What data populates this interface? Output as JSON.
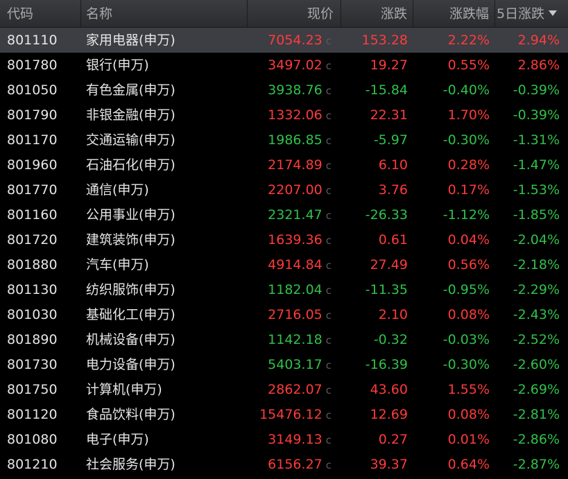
{
  "headers": {
    "code": "代码",
    "name": "名称",
    "price": "现价",
    "change": "涨跌",
    "pct": "涨跌幅",
    "five": "5日涨跌"
  },
  "cmark": "c",
  "colors": {
    "up": "#ff3b3b",
    "down": "#2fc24b",
    "selected_row": "#3c3e44"
  },
  "rows": [
    {
      "code": "801110",
      "name": "家用电器(申万)",
      "price": "7054.23",
      "change": "153.28",
      "pct": "2.22%",
      "five": "2.94%",
      "price_dir": "up",
      "change_dir": "up",
      "pct_dir": "up",
      "five_dir": "up"
    },
    {
      "code": "801780",
      "name": "银行(申万)",
      "price": "3497.02",
      "change": "19.27",
      "pct": "0.55%",
      "five": "2.86%",
      "price_dir": "up",
      "change_dir": "up",
      "pct_dir": "up",
      "five_dir": "up"
    },
    {
      "code": "801050",
      "name": "有色金属(申万)",
      "price": "3938.76",
      "change": "-15.84",
      "pct": "-0.40%",
      "five": "-0.39%",
      "price_dir": "down",
      "change_dir": "down",
      "pct_dir": "down",
      "five_dir": "down"
    },
    {
      "code": "801790",
      "name": "非银金融(申万)",
      "price": "1332.06",
      "change": "22.31",
      "pct": "1.70%",
      "five": "-0.39%",
      "price_dir": "up",
      "change_dir": "up",
      "pct_dir": "up",
      "five_dir": "down"
    },
    {
      "code": "801170",
      "name": "交通运输(申万)",
      "price": "1986.85",
      "change": "-5.97",
      "pct": "-0.30%",
      "five": "-1.31%",
      "price_dir": "down",
      "change_dir": "down",
      "pct_dir": "down",
      "five_dir": "down"
    },
    {
      "code": "801960",
      "name": "石油石化(申万)",
      "price": "2174.89",
      "change": "6.10",
      "pct": "0.28%",
      "five": "-1.47%",
      "price_dir": "up",
      "change_dir": "up",
      "pct_dir": "up",
      "five_dir": "down"
    },
    {
      "code": "801770",
      "name": "通信(申万)",
      "price": "2207.00",
      "change": "3.76",
      "pct": "0.17%",
      "five": "-1.53%",
      "price_dir": "up",
      "change_dir": "up",
      "pct_dir": "up",
      "five_dir": "down"
    },
    {
      "code": "801160",
      "name": "公用事业(申万)",
      "price": "2321.47",
      "change": "-26.33",
      "pct": "-1.12%",
      "five": "-1.85%",
      "price_dir": "down",
      "change_dir": "down",
      "pct_dir": "down",
      "five_dir": "down"
    },
    {
      "code": "801720",
      "name": "建筑装饰(申万)",
      "price": "1639.36",
      "change": "0.61",
      "pct": "0.04%",
      "five": "-2.04%",
      "price_dir": "up",
      "change_dir": "up",
      "pct_dir": "up",
      "five_dir": "down"
    },
    {
      "code": "801880",
      "name": "汽车(申万)",
      "price": "4914.84",
      "change": "27.49",
      "pct": "0.56%",
      "five": "-2.18%",
      "price_dir": "up",
      "change_dir": "up",
      "pct_dir": "up",
      "five_dir": "down"
    },
    {
      "code": "801130",
      "name": "纺织服饰(申万)",
      "price": "1182.04",
      "change": "-11.35",
      "pct": "-0.95%",
      "five": "-2.29%",
      "price_dir": "down",
      "change_dir": "down",
      "pct_dir": "down",
      "five_dir": "down"
    },
    {
      "code": "801030",
      "name": "基础化工(申万)",
      "price": "2716.05",
      "change": "2.10",
      "pct": "0.08%",
      "five": "-2.43%",
      "price_dir": "up",
      "change_dir": "up",
      "pct_dir": "up",
      "five_dir": "down"
    },
    {
      "code": "801890",
      "name": "机械设备(申万)",
      "price": "1142.18",
      "change": "-0.32",
      "pct": "-0.03%",
      "five": "-2.52%",
      "price_dir": "down",
      "change_dir": "down",
      "pct_dir": "down",
      "five_dir": "down"
    },
    {
      "code": "801730",
      "name": "电力设备(申万)",
      "price": "5403.17",
      "change": "-16.39",
      "pct": "-0.30%",
      "five": "-2.60%",
      "price_dir": "down",
      "change_dir": "down",
      "pct_dir": "down",
      "five_dir": "down"
    },
    {
      "code": "801750",
      "name": "计算机(申万)",
      "price": "2862.07",
      "change": "43.60",
      "pct": "1.55%",
      "five": "-2.69%",
      "price_dir": "up",
      "change_dir": "up",
      "pct_dir": "up",
      "five_dir": "down"
    },
    {
      "code": "801120",
      "name": "食品饮料(申万)",
      "price": "15476.12",
      "change": "12.69",
      "pct": "0.08%",
      "five": "-2.81%",
      "price_dir": "up",
      "change_dir": "up",
      "pct_dir": "up",
      "five_dir": "down"
    },
    {
      "code": "801080",
      "name": "电子(申万)",
      "price": "3149.13",
      "change": "0.27",
      "pct": "0.01%",
      "five": "-2.86%",
      "price_dir": "up",
      "change_dir": "up",
      "pct_dir": "up",
      "five_dir": "down"
    },
    {
      "code": "801210",
      "name": "社会服务(申万)",
      "price": "6156.27",
      "change": "39.37",
      "pct": "0.64%",
      "five": "-2.87%",
      "price_dir": "up",
      "change_dir": "up",
      "pct_dir": "up",
      "five_dir": "down"
    }
  ]
}
